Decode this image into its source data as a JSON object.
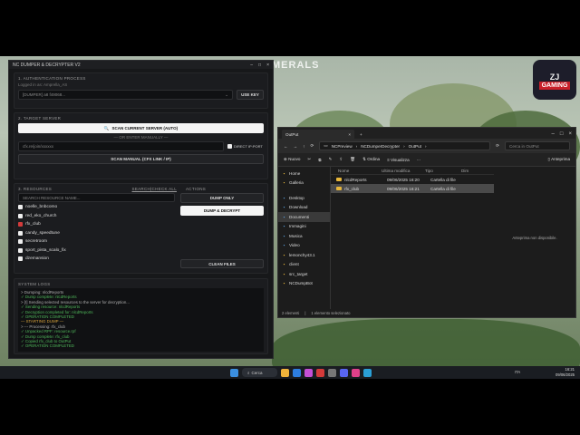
{
  "desktop": {
    "overlay_text": "MERALS",
    "logo_text": "ZJ",
    "logo_sub": "GAMING"
  },
  "dumper": {
    "title": "NC DUMPER & DECRYPTER V2",
    "section1": {
      "head": "1. AUTHENTICATION PROCESS",
      "sub": "Logged in as: Amprella_AS",
      "key_value": "[DUMPER] a8 f49068...",
      "use_key": "USE KEY"
    },
    "section2": {
      "head": "2. TARGET SERVER",
      "scan_auto": "SCAN CURRENT SERVER (AUTO)",
      "divider": "— OR ENTER MANUALLY —",
      "cfx_placeholder": "cfx.re/join/xxxxxx",
      "direct_ip": "DIRECT IP:PORT",
      "scan_manual": "SCAN MANUAL (CFX LINK / IP)"
    },
    "section3": {
      "head": "3. RESOURCES",
      "filter": "SEARCH|CHECK ALL",
      "actions_head": "ACTIONS",
      "search_placeholder": "SEARCH RESOURCE NAME...",
      "items": [
        {
          "name": "noelle_bnbcomo",
          "checked": false
        },
        {
          "name": "red_eko_church",
          "checked": false
        },
        {
          "name": "rfx_club",
          "checked": true
        },
        {
          "name": "candy_speedtune",
          "checked": false
        },
        {
          "name": "secretroom",
          "checked": false
        },
        {
          "name": "sport_pista_scalo_fix",
          "checked": false
        },
        {
          "name": "dzemansion",
          "checked": false
        }
      ],
      "dump_only": "DUMP ONLY",
      "dump_decrypt": "DUMP & DECRYPT",
      "clean_files": "CLEAN FILES"
    },
    "logs": {
      "head": "SYSTEM LOGS",
      "lines": [
        {
          "text": "> Dumping: nlcdReports",
          "kind": "normal"
        },
        {
          "text": "✓ Dump complete: nlcdReports",
          "kind": "ok"
        },
        {
          "text": "> [!] Sending selected resources to the server for decryption...",
          "kind": "normal"
        },
        {
          "text": "✓ Sending resource: nlcdReports",
          "kind": "ok"
        },
        {
          "text": "✓ Decryption completed for: nlcdReports",
          "kind": "ok"
        },
        {
          "text": "✓ OPERATION COMPLETED",
          "kind": "ok"
        },
        {
          "text": "— STARTING DUMP —",
          "kind": "warn"
        },
        {
          "text": "> --- Processing: rfx_club",
          "kind": "normal"
        },
        {
          "text": "✓ Unpacked RPF: resource.rpf",
          "kind": "ok"
        },
        {
          "text": "✓ Dump complete: rfx_club",
          "kind": "ok"
        },
        {
          "text": "✓ Copied rfx_club to OutPut",
          "kind": "ok"
        },
        {
          "text": "✓ OPERATION COMPLETED",
          "kind": "ok"
        }
      ]
    }
  },
  "explorer": {
    "tab_title": "OutPut",
    "breadcrumb": [
      "NCPreview",
      "NCDumperDecrypter",
      "OutPut"
    ],
    "search_placeholder": "Cerca in OutPut",
    "toolbar": {
      "new": "Nuovo",
      "sort": "Ordina",
      "view": "Visualizza",
      "preview": "Anteprima"
    },
    "sidebar": [
      "Home",
      "Galleria",
      "Desktop",
      "Download",
      "Documenti",
      "Immagini",
      "Musica",
      "Video",
      "lemonchy43.1",
      "client",
      "src_target",
      "NCDumpBot"
    ],
    "sidebar_active": 4,
    "columns": [
      "Nome",
      "Ultima modifica",
      "Tipo",
      "Dim"
    ],
    "rows": [
      {
        "name": "nlcdReports",
        "date": "09/06/2025 16:20",
        "type": "Cartella di file",
        "selected": false
      },
      {
        "name": "rfx_club",
        "date": "09/06/2025 16:21",
        "type": "Cartella di file",
        "selected": true
      }
    ],
    "preview_text": "Anteprima non disponibile.",
    "status": [
      "2 elementi",
      "1 elemento selezionato"
    ]
  },
  "taskbar": {
    "search": "Cerca",
    "time": "16:21",
    "date": "09/06/2025",
    "lang": "ITA"
  }
}
